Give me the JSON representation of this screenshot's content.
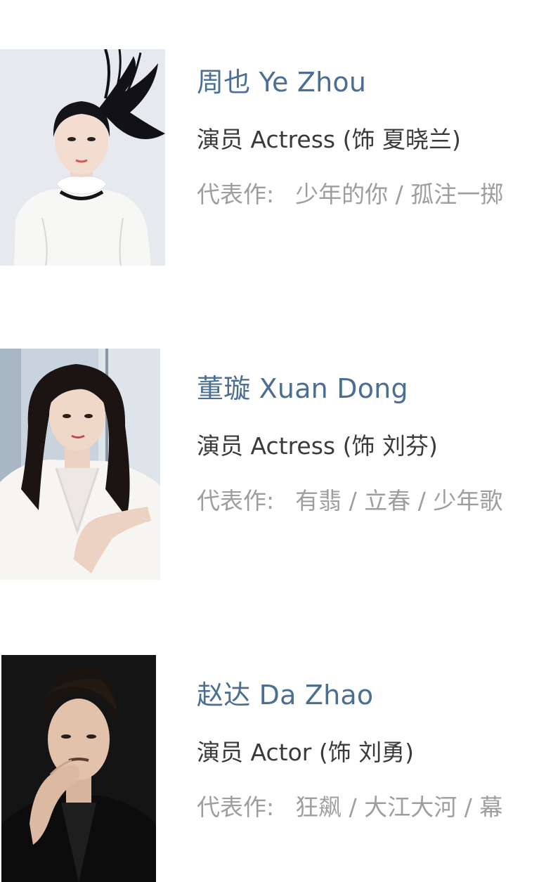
{
  "cast": [
    {
      "name": "周也 Ye Zhou",
      "role": "演员 Actress (饰 夏晓兰)",
      "works_label": "代表作:",
      "works": "少年的你 / 孤注一掷"
    },
    {
      "name": "董璇 Xuan Dong",
      "role": "演员 Actress (饰 刘芬)",
      "works_label": "代表作:",
      "works": "有翡 / 立春 / 少年歌"
    },
    {
      "name": "赵达 Da Zhao",
      "role": "演员 Actor (饰 刘勇)",
      "works_label": "代表作:",
      "works": "狂飙 / 大江大河 / 幕"
    }
  ],
  "colors": {
    "name": "#4a6f93",
    "role": "#3a3a3a",
    "works": "#9e9e9e"
  }
}
